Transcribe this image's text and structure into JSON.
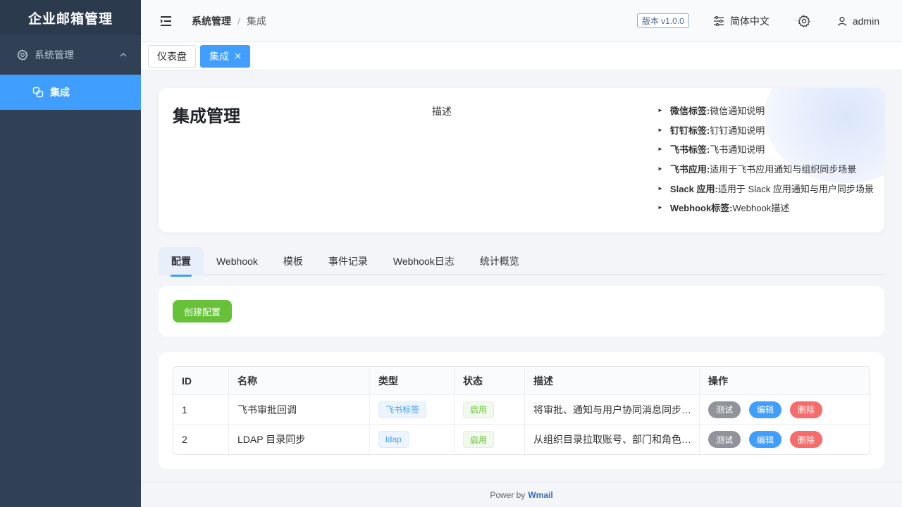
{
  "app": {
    "title": "企业邮箱管理"
  },
  "sidebar": {
    "group": {
      "label": "系统管理",
      "icon": "gear-icon"
    },
    "items": [
      {
        "label": "集成",
        "icon": "integration-icon",
        "active": true
      }
    ]
  },
  "header": {
    "breadcrumb": [
      "系统管理",
      "集成"
    ],
    "breadcrumb_sep": "/",
    "version": "版本 v1.0.0",
    "language": "简体中文",
    "user": "admin"
  },
  "tags": [
    {
      "label": "仪表盘",
      "active": false
    },
    {
      "label": "集成",
      "active": true
    }
  ],
  "intro": {
    "title": "集成管理",
    "desc_label": "描述",
    "features": [
      {
        "key": "微信标签:",
        "text": " 微信通知说明"
      },
      {
        "key": "钉钉标签:",
        "text": " 钉钉通知说明"
      },
      {
        "key": "飞书标签:",
        "text": " 飞书通知说明"
      },
      {
        "key": "飞书应用:",
        "text": " 适用于飞书应用通知与组织同步场景"
      },
      {
        "key": "Slack 应用:",
        "text": " 适用于 Slack 应用通知与用户同步场景"
      },
      {
        "key": "Webhook标签:",
        "text": " Webhook描述"
      }
    ]
  },
  "tabs": [
    {
      "label": "配置",
      "active": true
    },
    {
      "label": "Webhook",
      "active": false
    },
    {
      "label": "模板",
      "active": false
    },
    {
      "label": "事件记录",
      "active": false
    },
    {
      "label": "Webhook日志",
      "active": false
    },
    {
      "label": "统计概览",
      "active": false
    }
  ],
  "actions": {
    "create_label": "创建配置"
  },
  "table": {
    "columns": [
      "ID",
      "名称",
      "类型",
      "状态",
      "描述",
      "操作"
    ],
    "rows": [
      {
        "id": "1",
        "name": "飞书审批回调",
        "type": "飞书标签",
        "status": "启用",
        "desc": "将审批、通知与用户协同消息同步到飞书"
      },
      {
        "id": "2",
        "name": "LDAP 目录同步",
        "type": "ldap",
        "status": "启用",
        "desc": "从组织目录拉取账号、部门和角色信息"
      }
    ],
    "ops": {
      "test": "测试",
      "edit": "编辑",
      "delete": "删除"
    }
  },
  "footer": {
    "prefix": "Power by",
    "brand": "Wmail"
  },
  "colors": {
    "sidebar": "#304156",
    "accent": "#409eff",
    "success": "#67c23a",
    "danger": "#f56c6c",
    "info": "#909399"
  }
}
